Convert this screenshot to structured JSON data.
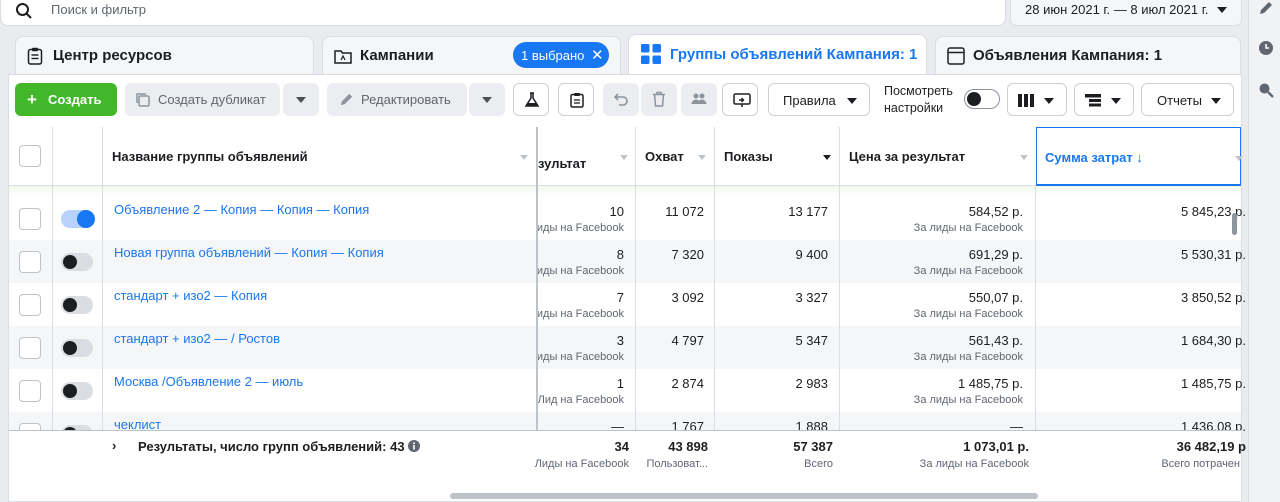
{
  "search": {
    "placeholder": "Поиск и фильтр"
  },
  "date_range": "28 июн 2021 г. — 8 июл 2021 г.",
  "tabs": [
    {
      "label": "Центр ресурсов"
    },
    {
      "label": "Кампании"
    },
    {
      "label": "Группы объявлений Кампания: 1"
    },
    {
      "label": "Объявления Кампания: 1"
    }
  ],
  "selection_badge": "1 выбрано",
  "toolbar": {
    "create": "Создать",
    "duplicate": "Создать дубликат",
    "edit": "Редактировать",
    "rules": "Правила",
    "view_settings": "Посмотреть настройки",
    "reports": "Отчеты"
  },
  "columns": {
    "name": "Название группы объявлений",
    "result": "зультат",
    "reach": "Охват",
    "impressions": "Показы",
    "cost_per_result": "Цена за результат",
    "amount_spent": "Сумма затрат ↓"
  },
  "rows": [
    {
      "name": "Объявление 2 — Копия — Копия — Копия",
      "on": true,
      "result": "10",
      "result_sub": "иды на Facebook",
      "reach": "11 072",
      "impressions": "13 177",
      "cpr": "584,52 р.",
      "cpr_sub": "За лиды на Facebook",
      "spent": "5 845,23 р."
    },
    {
      "name": "Новая группа объявлений — Копия — Копия",
      "on": false,
      "result": "8",
      "result_sub": "иды на Facebook",
      "reach": "7 320",
      "impressions": "9 400",
      "cpr": "691,29 р.",
      "cpr_sub": "За лиды на Facebook",
      "spent": "5 530,31 р."
    },
    {
      "name": "стандарт + изо2 — Копия",
      "on": false,
      "result": "7",
      "result_sub": "иды на Facebook",
      "reach": "3 092",
      "impressions": "3 327",
      "cpr": "550,07 р.",
      "cpr_sub": "За лиды на Facebook",
      "spent": "3 850,52 р."
    },
    {
      "name": "стандарт + изо2 — / Ростов",
      "on": false,
      "result": "3",
      "result_sub": "иды на Facebook",
      "reach": "4 797",
      "impressions": "5 347",
      "cpr": "561,43 р.",
      "cpr_sub": "За лиды на Facebook",
      "spent": "1 684,30 р."
    },
    {
      "name": "Москва /Объявление 2 — июль",
      "on": false,
      "result": "1",
      "result_sub": "Лид на Facebook",
      "reach": "2 874",
      "impressions": "2 983",
      "cpr": "1 485,75 р.",
      "cpr_sub": "За лиды на Facebook",
      "spent": "1 485,75 р."
    },
    {
      "name": "чеклист",
      "on": false,
      "result": "—",
      "result_sub": "",
      "reach": "1 767",
      "impressions": "1 888",
      "cpr": "—",
      "cpr_sub": "",
      "spent": "1 436,08 р."
    }
  ],
  "footer": {
    "label": "Результаты, число групп объявлений: 43",
    "result": "34",
    "result_sub": "Лиды на Facebook",
    "reach": "43 898",
    "reach_sub": "Пользоват...",
    "impressions": "57 387",
    "impressions_sub": "Всего",
    "cpr": "1 073,01 р.",
    "cpr_sub": "За лиды на Facebook",
    "spent": "36 482,19 р",
    "spent_sub": "Всего потрачен"
  },
  "colors": {
    "accent": "#1877f2",
    "create": "#42b72a"
  }
}
